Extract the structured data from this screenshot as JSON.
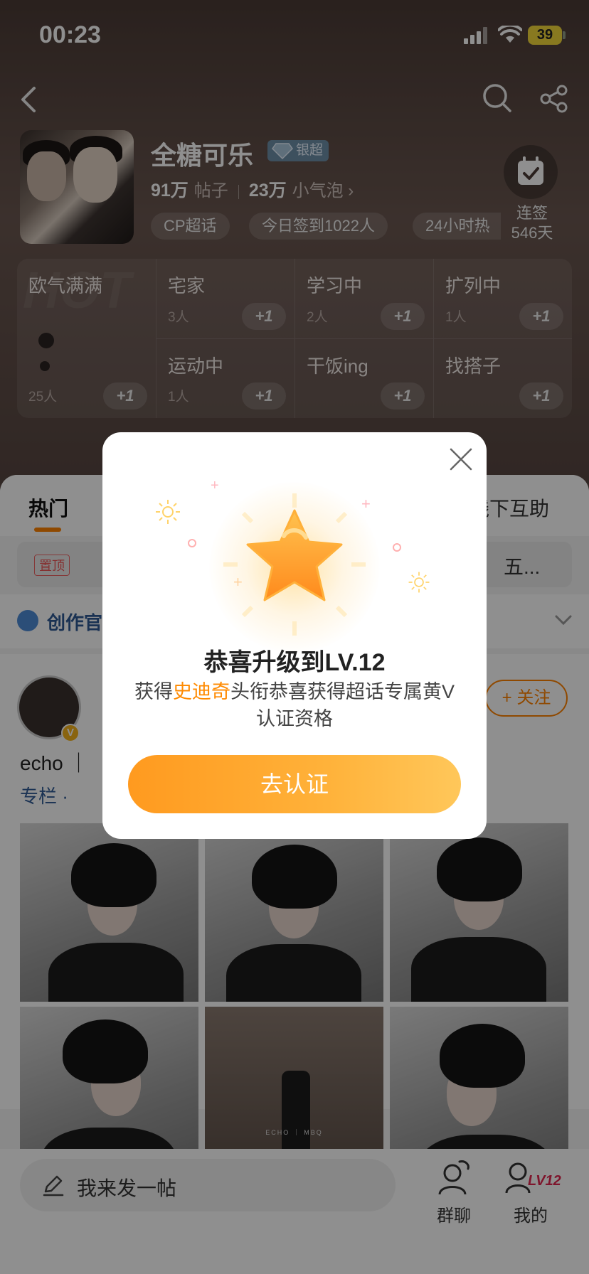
{
  "status_bar": {
    "time": "00:23",
    "battery": "39"
  },
  "topic": {
    "name": "全糖可乐",
    "badge": "银超",
    "posts_count": "91万",
    "posts_label": "帖子",
    "members_count": "23万",
    "members_label": "小气泡",
    "tags": [
      "CP超话",
      "今日签到1022人",
      "24小时热"
    ],
    "checkin_label": "连签",
    "checkin_days": "546天"
  },
  "moods": {
    "featured": {
      "title": "欧气满满",
      "count": "25人",
      "plus": "+1"
    },
    "cells": [
      {
        "title": "宅家",
        "count": "3人",
        "plus": "+1"
      },
      {
        "title": "学习中",
        "count": "2人",
        "plus": "+1"
      },
      {
        "title": "扩列中",
        "count": "1人",
        "plus": "+1"
      },
      {
        "title": "运动中",
        "count": "1人",
        "plus": "+1"
      },
      {
        "title": "干饭ing",
        "count": "",
        "plus": "+1"
      },
      {
        "title": "找搭子",
        "count": "",
        "plus": "+1"
      }
    ]
  },
  "tabs": [
    "热门",
    "线下互助"
  ],
  "pinned": {
    "badge": "置顶",
    "text": "五..."
  },
  "creator_label": "创作官",
  "post": {
    "follow_label": "+ 关注",
    "text": "echo ｜",
    "column_label": "专栏 ·",
    "verified_mark": "V",
    "photo_caption": "ECHO ｜ MBQ"
  },
  "bottom": {
    "compose_placeholder": "我来发一帖",
    "group_chat_label": "群聊",
    "mine_label": "我的",
    "level_badge": "LV12"
  },
  "modal": {
    "title": "恭喜升级到LV.12",
    "desc_prefix": "获得",
    "desc_highlight": "史迪奇",
    "desc_suffix": "头衔恭喜获得超话专属黄V认证资格",
    "cta": "去认证"
  },
  "colors": {
    "accent": "#ff8200",
    "highlight": "#ff8a00",
    "link_blue": "#2f5a94"
  }
}
